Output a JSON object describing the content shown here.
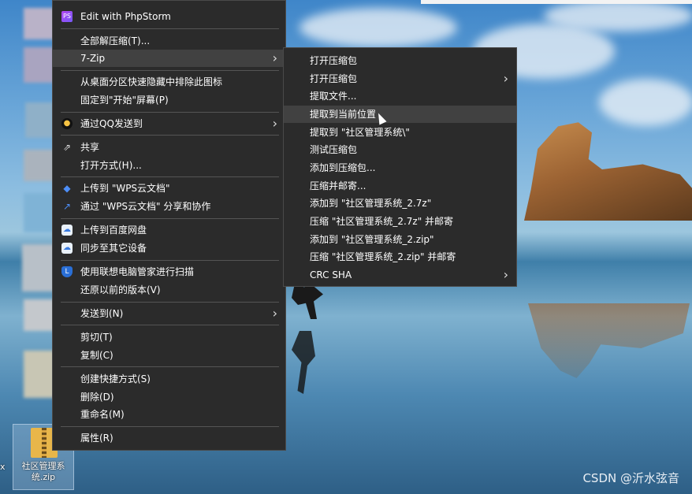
{
  "desktop": {
    "file_label": "社区管理系统.zip",
    "left_cut_label": "x"
  },
  "main_menu": {
    "items": [
      {
        "label": "Edit with PhpStorm",
        "icon": "phpstorm-icon"
      },
      {
        "label": "全部解压缩(T)..."
      },
      {
        "label": "7-Zip",
        "submenu": true
      },
      {
        "label": "从桌面分区快速隐藏中排除此图标"
      },
      {
        "label": "固定到\"开始\"屏幕(P)"
      },
      {
        "label": "通过QQ发送到",
        "icon": "qq-icon",
        "submenu": true
      },
      {
        "label": "共享",
        "icon": "share-icon"
      },
      {
        "label": "打开方式(H)..."
      },
      {
        "label": "上传到 \"WPS云文档\"",
        "icon": "wps-upload-icon"
      },
      {
        "label": "通过 \"WPS云文档\" 分享和协作",
        "icon": "wps-share-icon"
      },
      {
        "label": "上传到百度网盘",
        "icon": "baidu-netdisk-icon"
      },
      {
        "label": "同步至其它设备",
        "icon": "baidu-sync-icon"
      },
      {
        "label": "使用联想电脑管家进行扫描",
        "icon": "lenovo-shield-icon"
      },
      {
        "label": "还原以前的版本(V)"
      },
      {
        "label": "发送到(N)",
        "submenu": true
      },
      {
        "label": "剪切(T)"
      },
      {
        "label": "复制(C)"
      },
      {
        "label": "创建快捷方式(S)"
      },
      {
        "label": "删除(D)"
      },
      {
        "label": "重命名(M)"
      },
      {
        "label": "属性(R)"
      }
    ]
  },
  "sub_menu": {
    "items": [
      {
        "label": "打开压缩包"
      },
      {
        "label": "打开压缩包",
        "submenu": true
      },
      {
        "label": "提取文件..."
      },
      {
        "label": "提取到当前位置",
        "highlighted": true
      },
      {
        "label": "提取到 \"社区管理系统\\\""
      },
      {
        "label": "测试压缩包"
      },
      {
        "label": "添加到压缩包..."
      },
      {
        "label": "压缩并邮寄..."
      },
      {
        "label": "添加到 \"社区管理系统_2.7z\""
      },
      {
        "label": "压缩 \"社区管理系统_2.7z\" 并邮寄"
      },
      {
        "label": "添加到 \"社区管理系统_2.zip\""
      },
      {
        "label": "压缩 \"社区管理系统_2.zip\" 并邮寄"
      },
      {
        "label": "CRC SHA",
        "submenu": true
      }
    ]
  },
  "watermark": "CSDN @沂水弦音",
  "colors": {
    "menu_bg": "#2b2b2b",
    "menu_highlight": "#414141",
    "text": "#ffffff"
  }
}
